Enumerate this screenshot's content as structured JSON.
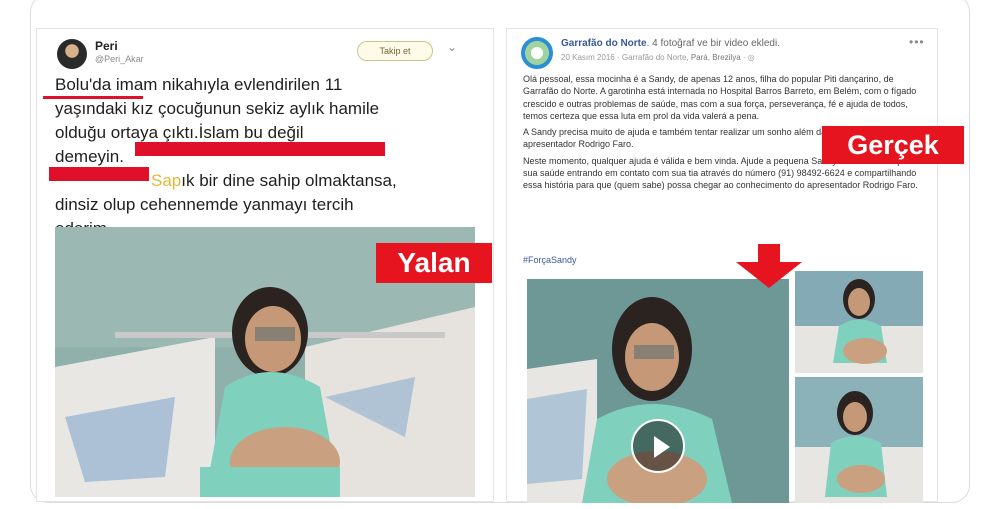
{
  "left_tweet": {
    "author_name": "Peri",
    "author_handle": "@Peri_Akar",
    "follow_label": "Takip et",
    "line1": "Bolu'da imam nikahıyla evlendirilen 11",
    "line2": "yaşındaki kız çocuğunun sekiz aylık hamile",
    "line3": "olduğu ortaya çıktı.İslam bu değil",
    "line4": "demeyin.",
    "line5_highlight": "Sap",
    "line5_rest": "ık bir dine sahip olmaktansa,",
    "line6": "dinsiz olup cehennemde yanmayı tercih",
    "line7": "ederim."
  },
  "stamps": {
    "fake": "Yalan",
    "real": "Gerçek"
  },
  "right_post": {
    "page_name": "Garrafão do Norte",
    "action": ". 4 fotoğraf ve bir video ekledi.",
    "date": "20 Kasım 2016 · Garrafão do Norte, ",
    "location": "Pará, Brezilya",
    "privacy": " · ◎",
    "para1": "Olá pessoal, essa mocinha é a Sandy, de apenas 12 anos, filha do popular Piti dançarino, de Garrafão do Norte. A garotinha está internada no Hospital Barros Barreto, em Belém, com o fígado crescido e outras problemas de saúde, mas com a sua força, perseverança, fé e ajuda de todos, temos certeza que essa luta em prol da vida valerá a pena.",
    "para2": "A Sandy precisa muito de ajuda e também tentar realizar um sonho além da sua cura: conhecer o apresentador Rodrigo Faro.",
    "para3": "Neste momento, qualquer ajuda é válida e bem vinda. Ajude a pequena Sandy no tratamento pela sua saúde entrando em contato com sua tia através do número (91) 98492-6624 e compartilhando essa história para que (quem sabe) possa chegar ao conhecimento do apresentador Rodrigo Faro.",
    "hashtag": "#ForçaSandy"
  }
}
